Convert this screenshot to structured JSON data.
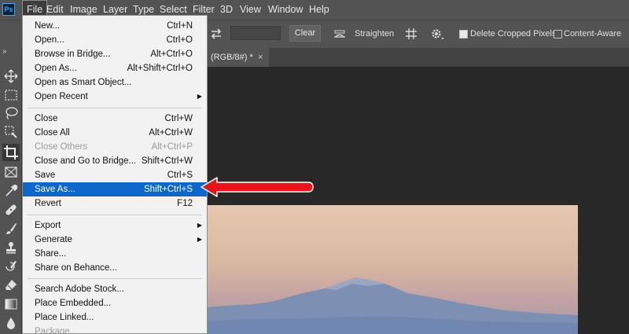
{
  "app": {
    "logo": "Ps"
  },
  "menubar": [
    {
      "label": "File",
      "active": true
    },
    {
      "label": "Edit"
    },
    {
      "label": "Image"
    },
    {
      "label": "Layer"
    },
    {
      "label": "Type"
    },
    {
      "label": "Select"
    },
    {
      "label": "Filter"
    },
    {
      "label": "3D"
    },
    {
      "label": "View"
    },
    {
      "label": "Window"
    },
    {
      "label": "Help"
    }
  ],
  "options_bar": {
    "icons": [
      "rotate-swap-icon",
      "straighten-icon",
      "grid-overlay-icon",
      "gear-icon"
    ],
    "clear_button": "Clear",
    "straighten_label": "Straighten",
    "delete_cropped": {
      "label": "Delete Cropped Pixels",
      "checked": true
    },
    "content_aware": {
      "label": "Content-Aware",
      "checked": false
    }
  },
  "document_tab": {
    "label": "(RGB/8#) *",
    "close": "×"
  },
  "toolbar": {
    "collapse": "»",
    "tools": [
      "move-tool-icon",
      "marquee-tool-icon",
      "lasso-tool-icon",
      "quick-selection-tool-icon",
      "crop-tool-icon",
      "frame-tool-icon",
      "eyedropper-tool-icon",
      "healing-brush-tool-icon",
      "brush-tool-icon",
      "clone-stamp-tool-icon",
      "history-brush-tool-icon",
      "eraser-tool-icon",
      "gradient-tool-icon",
      "blur-tool-icon"
    ]
  },
  "file_menu": {
    "items": [
      {
        "label": "New...",
        "shortcut": "Ctrl+N"
      },
      {
        "label": "Open...",
        "shortcut": "Ctrl+O"
      },
      {
        "label": "Browse in Bridge...",
        "shortcut": "Alt+Ctrl+O"
      },
      {
        "label": "Open As...",
        "shortcut": "Alt+Shift+Ctrl+O"
      },
      {
        "label": "Open as Smart Object...",
        "shortcut": ""
      },
      {
        "label": "Open Recent",
        "shortcut": "",
        "submenu": true
      },
      {
        "separator": true
      },
      {
        "label": "Close",
        "shortcut": "Ctrl+W"
      },
      {
        "label": "Close All",
        "shortcut": "Alt+Ctrl+W"
      },
      {
        "label": "Close Others",
        "shortcut": "Alt+Ctrl+P",
        "disabled": true
      },
      {
        "label": "Close and Go to Bridge...",
        "shortcut": "Shift+Ctrl+W"
      },
      {
        "label": "Save",
        "shortcut": "Ctrl+S"
      },
      {
        "label": "Save As...",
        "shortcut": "Shift+Ctrl+S",
        "highlighted": true
      },
      {
        "label": "Revert",
        "shortcut": "F12"
      },
      {
        "separator": true
      },
      {
        "label": "Export",
        "shortcut": "",
        "submenu": true
      },
      {
        "label": "Generate",
        "shortcut": "",
        "submenu": true
      },
      {
        "label": "Share...",
        "shortcut": ""
      },
      {
        "label": "Share on Behance...",
        "shortcut": ""
      },
      {
        "separator": true
      },
      {
        "label": "Search Adobe Stock...",
        "shortcut": ""
      },
      {
        "label": "Place Embedded...",
        "shortcut": ""
      },
      {
        "label": "Place Linked...",
        "shortcut": ""
      },
      {
        "label": "Package...",
        "shortcut": "",
        "disabled": true
      }
    ]
  },
  "annotation": {
    "color": "#e8141b",
    "points_to": "Save As..."
  }
}
